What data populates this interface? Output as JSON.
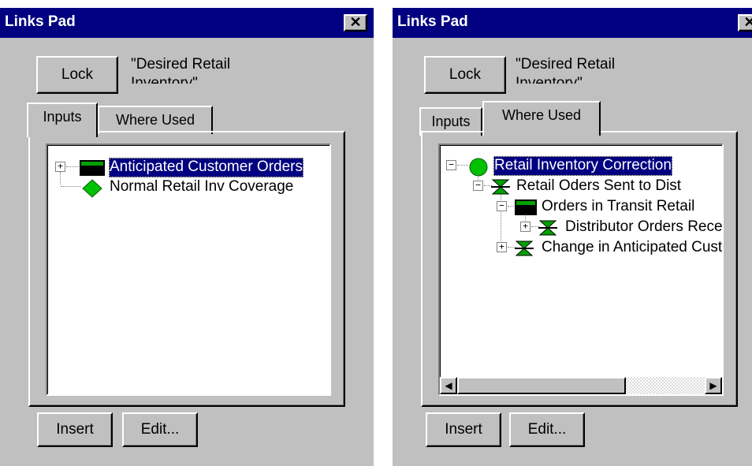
{
  "left_window": {
    "title": "Links Pad",
    "close_label": "✕",
    "lock_label": "Lock",
    "selected_variable": "\"Desired Retail Inventory\"",
    "tabs": [
      {
        "label": "Inputs",
        "active": true
      },
      {
        "label": "Where Used",
        "active": false
      }
    ],
    "tree": [
      {
        "label": "Anticipated Customer Orders",
        "icon": "stock-icon",
        "expander": "+",
        "selected": true
      },
      {
        "label": "Normal Retail Inv Coverage",
        "icon": "converter-icon",
        "expander": "",
        "selected": false
      }
    ],
    "insert_label": "Insert",
    "edit_label": "Edit..."
  },
  "right_window": {
    "title": "Links Pad",
    "close_label": "✕",
    "lock_label": "Lock",
    "selected_variable": "\"Desired Retail Inventory\"",
    "tabs": [
      {
        "label": "Inputs",
        "active": false
      },
      {
        "label": "Where Used",
        "active": true
      }
    ],
    "tree": [
      {
        "label": "Retail Inventory Correction",
        "icon": "auxiliary-icon",
        "expander": "−",
        "depth": 0,
        "selected": true
      },
      {
        "label": "Retail Oders Sent to Dist",
        "icon": "flow-icon",
        "expander": "−",
        "depth": 1,
        "selected": false
      },
      {
        "label": "Orders in Transit Retail",
        "icon": "stock-icon",
        "expander": "−",
        "depth": 2,
        "selected": false
      },
      {
        "label": "Distributor Orders Received",
        "icon": "flow-icon",
        "expander": "+",
        "depth": 3,
        "selected": false
      },
      {
        "label": "Change in Anticipated Customer Orders",
        "icon": "flow-icon",
        "expander": "+",
        "depth": 2,
        "selected": false
      }
    ],
    "scroll_left_label": "◀",
    "scroll_right_label": "▶",
    "insert_label": "Insert",
    "edit_label": "Edit..."
  },
  "colors": {
    "title_bar": "#000080",
    "selection": "#000080",
    "stock": "#008000",
    "flow": "#008000",
    "converter": "#00c000",
    "window_face": "#c0c0c0"
  }
}
